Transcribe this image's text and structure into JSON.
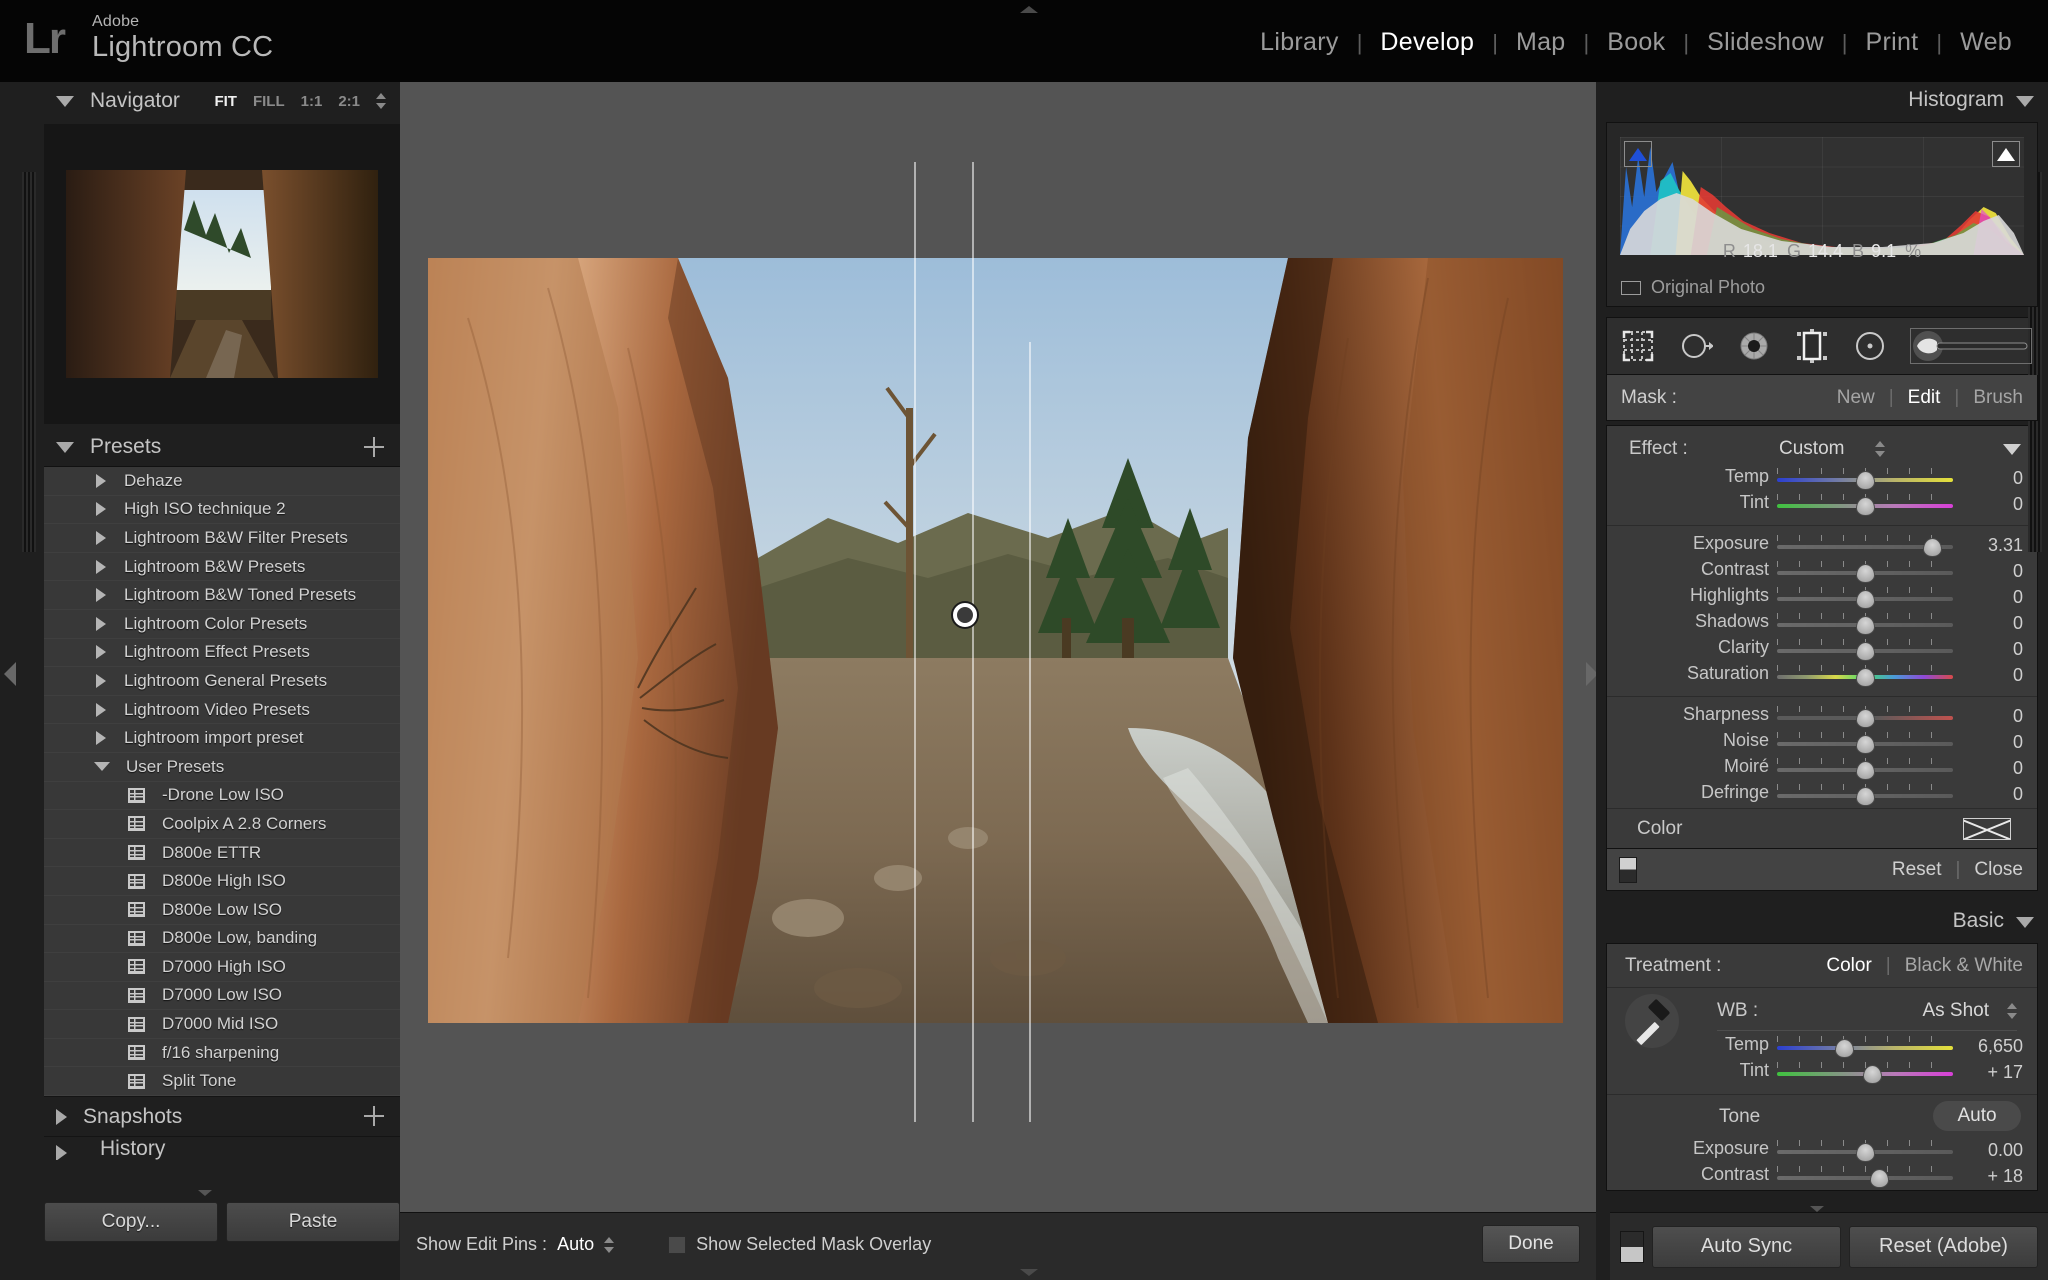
{
  "app": {
    "logo_mark": "Lr",
    "brand_line1": "Adobe",
    "brand_line2": "Lightroom CC"
  },
  "modules": [
    {
      "label": "Library",
      "active": false
    },
    {
      "label": "Develop",
      "active": true
    },
    {
      "label": "Map",
      "active": false
    },
    {
      "label": "Book",
      "active": false
    },
    {
      "label": "Slideshow",
      "active": false
    },
    {
      "label": "Print",
      "active": false
    },
    {
      "label": "Web",
      "active": false
    }
  ],
  "left_panel": {
    "navigator": {
      "title": "Navigator",
      "zoom_levels": [
        {
          "label": "FIT",
          "active": true
        },
        {
          "label": "FILL",
          "active": false
        },
        {
          "label": "1:1",
          "active": false
        },
        {
          "label": "2:1",
          "active": false
        }
      ]
    },
    "presets": {
      "title": "Presets",
      "groups": [
        {
          "label": "Dehaze",
          "type": "folder",
          "expanded": false
        },
        {
          "label": "High ISO technique 2",
          "type": "folder",
          "expanded": false
        },
        {
          "label": "Lightroom B&W Filter Presets",
          "type": "folder",
          "expanded": false
        },
        {
          "label": "Lightroom B&W Presets",
          "type": "folder",
          "expanded": false
        },
        {
          "label": "Lightroom B&W Toned Presets",
          "type": "folder",
          "expanded": false
        },
        {
          "label": "Lightroom Color Presets",
          "type": "folder",
          "expanded": false
        },
        {
          "label": "Lightroom Effect Presets",
          "type": "folder",
          "expanded": false
        },
        {
          "label": "Lightroom General Presets",
          "type": "folder",
          "expanded": false
        },
        {
          "label": "Lightroom Video Presets",
          "type": "folder",
          "expanded": false
        },
        {
          "label": "Lightroom import preset",
          "type": "folder",
          "expanded": false
        },
        {
          "label": "User Presets",
          "type": "folder",
          "expanded": true
        },
        {
          "label": "-Drone Low ISO",
          "type": "preset"
        },
        {
          "label": "Coolpix A 2.8 Corners",
          "type": "preset"
        },
        {
          "label": "D800e ETTR",
          "type": "preset"
        },
        {
          "label": "D800e High ISO",
          "type": "preset"
        },
        {
          "label": "D800e Low ISO",
          "type": "preset"
        },
        {
          "label": "D800e Low, banding",
          "type": "preset"
        },
        {
          "label": "D7000 High ISO",
          "type": "preset"
        },
        {
          "label": "D7000 Low ISO",
          "type": "preset"
        },
        {
          "label": "D7000 Mid ISO",
          "type": "preset"
        },
        {
          "label": "f/16 sharpening",
          "type": "preset"
        },
        {
          "label": "Split Tone",
          "type": "preset"
        }
      ]
    },
    "snapshots_title": "Snapshots",
    "history_title": "History",
    "copy_button": "Copy...",
    "paste_button": "Paste"
  },
  "center": {
    "toolbar": {
      "show_edit_pins_label": "Show Edit Pins :",
      "show_edit_pins_value": "Auto",
      "show_mask_overlay_label": "Show Selected Mask Overlay",
      "show_mask_overlay_checked": false,
      "done_button": "Done"
    }
  },
  "right_panel": {
    "histogram": {
      "title": "Histogram",
      "readout": {
        "r_label": "R",
        "r": "18.1",
        "g_label": "G",
        "g": "14.4",
        "b_label": "B",
        "b": "9.1",
        "unit": "%"
      },
      "original_photo_label": "Original Photo"
    },
    "mask_tools": [
      {
        "name": "crop-tool",
        "selected": false
      },
      {
        "name": "spot-removal-tool",
        "selected": false
      },
      {
        "name": "red-eye-tool",
        "selected": false
      },
      {
        "name": "graduated-filter-tool",
        "selected": false
      },
      {
        "name": "radial-filter-tool",
        "selected": false
      },
      {
        "name": "adjustment-brush-tool",
        "selected": true
      }
    ],
    "mask_bar": {
      "label": "Mask :",
      "new_label": "New",
      "edit_label": "Edit",
      "brush_label": "Brush",
      "active": "Edit"
    },
    "effect": {
      "label": "Effect :",
      "value": "Custom",
      "sliders": [
        {
          "name": "Temp",
          "value": "0",
          "pos": 50,
          "type": "temp"
        },
        {
          "name": "Tint",
          "value": "0",
          "pos": 50,
          "type": "tint"
        },
        {
          "name": "Exposure",
          "value": "3.31",
          "pos": 88,
          "type": "plain"
        },
        {
          "name": "Contrast",
          "value": "0",
          "pos": 50,
          "type": "plain"
        },
        {
          "name": "Highlights",
          "value": "0",
          "pos": 50,
          "type": "plain"
        },
        {
          "name": "Shadows",
          "value": "0",
          "pos": 50,
          "type": "plain"
        },
        {
          "name": "Clarity",
          "value": "0",
          "pos": 50,
          "type": "plain"
        },
        {
          "name": "Saturation",
          "value": "0",
          "pos": 50,
          "type": "sat"
        },
        {
          "name": "Sharpness",
          "value": "0",
          "pos": 50,
          "type": "sharp"
        },
        {
          "name": "Noise",
          "value": "0",
          "pos": 50,
          "type": "plain"
        },
        {
          "name": "Moiré",
          "value": "0",
          "pos": 50,
          "type": "plain"
        },
        {
          "name": "Defringe",
          "value": "0",
          "pos": 50,
          "type": "plain"
        }
      ],
      "color_label": "Color",
      "reset_label": "Reset",
      "close_label": "Close"
    },
    "basic": {
      "title": "Basic",
      "treatment_label": "Treatment :",
      "treatment_color": "Color",
      "treatment_bw": "Black & White",
      "treatment_active": "Color",
      "wb_label": "WB :",
      "wb_value": "As Shot",
      "wb_sliders": [
        {
          "name": "Temp",
          "value": "6,650",
          "pos": 38,
          "type": "temp"
        },
        {
          "name": "Tint",
          "value": "+ 17",
          "pos": 54,
          "type": "tint"
        }
      ],
      "tone_label": "Tone",
      "auto_label": "Auto",
      "tone_sliders": [
        {
          "name": "Exposure",
          "value": "0.00",
          "pos": 50,
          "type": "plain"
        },
        {
          "name": "Contrast",
          "value": "+ 18",
          "pos": 58,
          "type": "plain"
        }
      ]
    },
    "bottom": {
      "auto_sync_label": "Auto Sync",
      "reset_label": "Reset (Adobe)"
    }
  },
  "colors": {
    "panel_bg": "#1f1f1f",
    "canvas_bg": "#545454",
    "accent_text": "#ffffff",
    "muted_text": "#9b9b9b",
    "clip_blue": "#1f4fd8"
  }
}
